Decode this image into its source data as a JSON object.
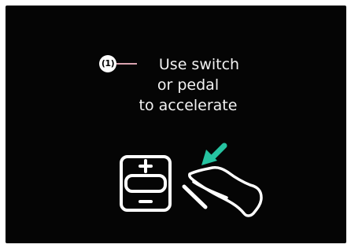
{
  "instruction": {
    "callout_number": "(1)",
    "line1": "Use switch",
    "line2": "or pedal",
    "line3": "to accelerate"
  },
  "icons": {
    "switch": "plus-minus-switch-icon",
    "pedal": "pedal-icon",
    "shoe": "shoe-icon",
    "arrow": "arrow-icon"
  },
  "colors": {
    "background": "#050505",
    "foreground": "#ffffff",
    "accent_arrow": "#26c3a1",
    "callout_line": "#d9a3b0"
  }
}
